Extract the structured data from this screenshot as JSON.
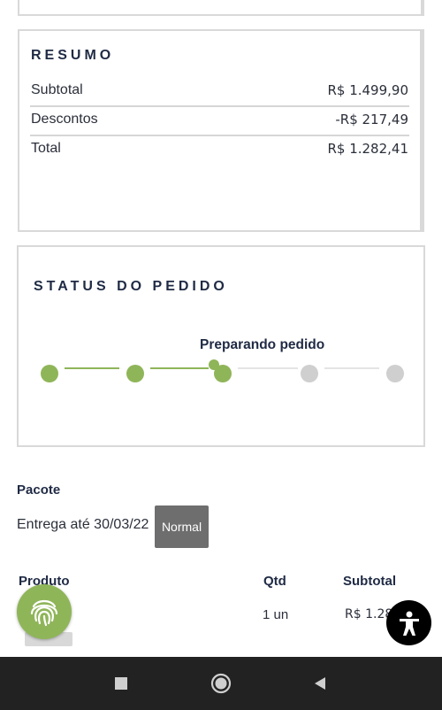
{
  "resumo": {
    "title": "RESUMO",
    "rows": [
      {
        "label": "Subtotal",
        "value": "R$ 1.499,90"
      },
      {
        "label": "Descontos",
        "value": "-R$ 217,49"
      },
      {
        "label": "Total",
        "value": "R$ 1.282,41"
      }
    ]
  },
  "status": {
    "title": "STATUS DO PEDIDO",
    "current_step_label": "Preparando pedido",
    "steps_total": 5,
    "steps_completed": 3,
    "colors": {
      "done": "#8fb559",
      "todo": "#cfcfcf"
    }
  },
  "pacote": {
    "title": "Pacote",
    "delivery_text": "Entrega até 30/03/22",
    "shipping_badge": "Normal"
  },
  "products_table": {
    "headers": {
      "product": "Produto",
      "qty": "Qtd",
      "subtotal": "Subtotal"
    },
    "rows": [
      {
        "qty": "1 un",
        "subtotal": "R$ 1.28"
      }
    ]
  },
  "icons": {
    "fingerprint_fab": "fingerprint-icon",
    "accessibility_fab": "accessibility-icon",
    "nav_recent": "square-icon",
    "nav_home": "circle-icon",
    "nav_back": "triangle-back-icon"
  }
}
